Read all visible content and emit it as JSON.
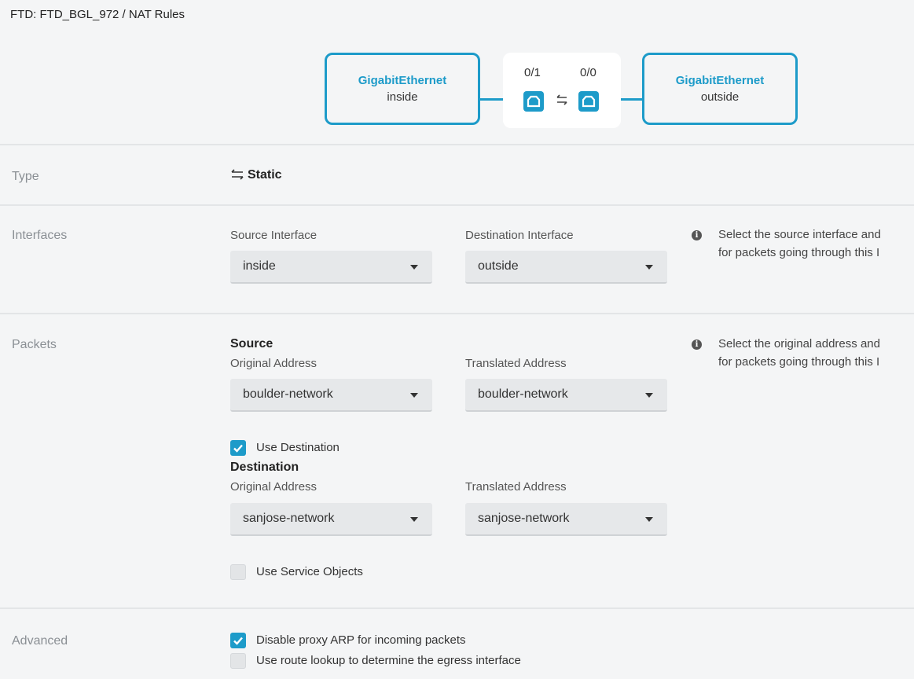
{
  "breadcrumb": "FTD: FTD_BGL_972 / NAT Rules",
  "topology": {
    "source": {
      "type": "GigabitEthernet",
      "zone": "inside"
    },
    "destination": {
      "type": "GigabitEthernet",
      "zone": "outside"
    },
    "source_port": "0/1",
    "destination_port": "0/0"
  },
  "type": {
    "label": "Type",
    "value": "Static"
  },
  "interfaces": {
    "label": "Interfaces",
    "source_label": "Source Interface",
    "source_value": "inside",
    "destination_label": "Destination Interface",
    "destination_value": "outside",
    "help_line1": "Select the source interface and",
    "help_line2": "for packets going through this I"
  },
  "packets": {
    "label": "Packets",
    "source_heading": "Source",
    "source_original_label": "Original Address",
    "source_original_value": "boulder-network",
    "source_translated_label": "Translated Address",
    "source_translated_value": "boulder-network",
    "use_destination_label": "Use Destination",
    "use_destination_checked": true,
    "destination_heading": "Destination",
    "destination_original_label": "Original Address",
    "destination_original_value": "sanjose-network",
    "destination_translated_label": "Translated Address",
    "destination_translated_value": "sanjose-network",
    "use_service_objects_label": "Use Service Objects",
    "use_service_objects_checked": false,
    "help_line1": "Select the original address and",
    "help_line2": "for packets going through this I"
  },
  "advanced": {
    "label": "Advanced",
    "disable_proxy_arp_label": "Disable proxy ARP for incoming packets",
    "disable_proxy_arp_checked": true,
    "route_lookup_label": "Use route lookup to determine the egress interface",
    "route_lookup_checked": false
  },
  "colors": {
    "accent": "#1d9bc9",
    "background": "#f4f5f6"
  },
  "icons": [
    "swap-arrows-icon",
    "ethernet-port-icon",
    "caret-down-icon",
    "info-icon",
    "checkmark-icon"
  ]
}
